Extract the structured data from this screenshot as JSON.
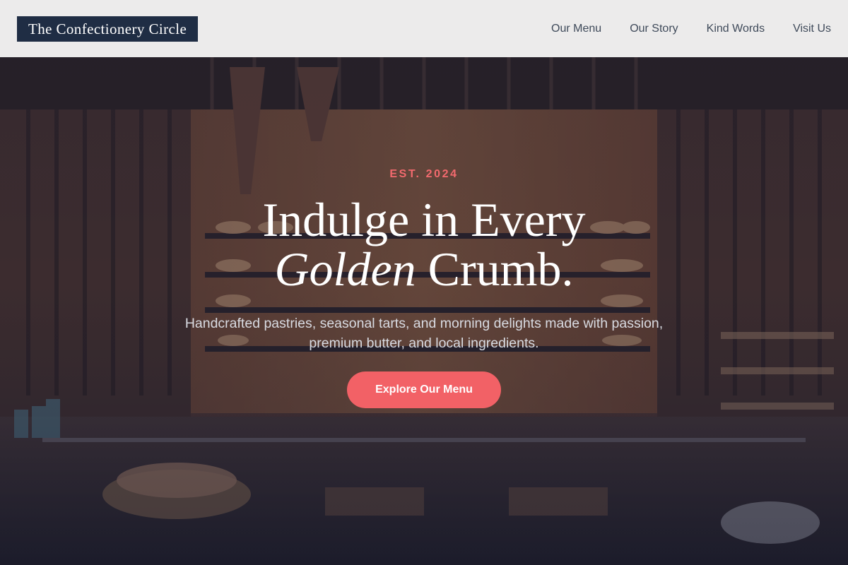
{
  "brand": {
    "logo_text": "The Confectionery Circle"
  },
  "nav": {
    "items": [
      {
        "label": "Our Menu"
      },
      {
        "label": "Our Story"
      },
      {
        "label": "Kind Words"
      },
      {
        "label": "Visit Us"
      }
    ]
  },
  "hero": {
    "eyebrow": "EST. 2024",
    "headline_line1": "Indulge in Every",
    "headline_italic": "Golden",
    "headline_rest": "Crumb.",
    "subtitle": "Handcrafted pastries, seasonal tarts, and morning delights made with passion, premium butter, and local ingredients.",
    "cta_label": "Explore Our Menu"
  },
  "colors": {
    "logo_background": "#1f2d44",
    "accent": "#f26166",
    "eyebrow": "#f26a6e",
    "nav_text": "#3f4a5a",
    "subtitle_text": "#d9dbe2"
  }
}
